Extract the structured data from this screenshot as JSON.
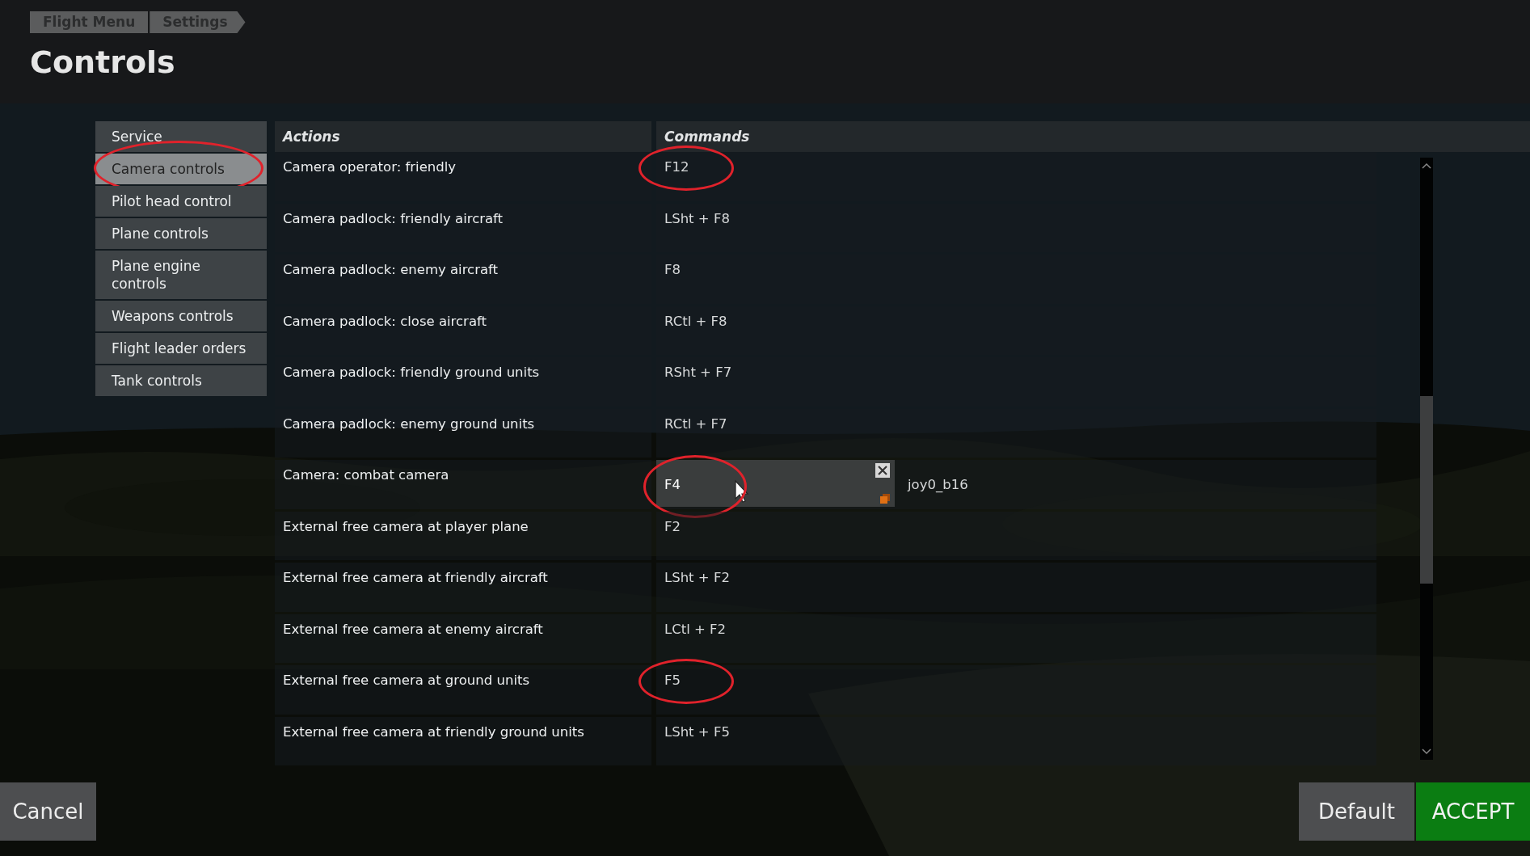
{
  "breadcrumb": [
    "Flight Menu",
    "Settings"
  ],
  "title": "Controls",
  "sidebar": {
    "items": [
      {
        "label": "Service",
        "selected": false,
        "circled": false
      },
      {
        "label": "Camera controls",
        "selected": true,
        "circled": true
      },
      {
        "label": "Pilot head control",
        "selected": false,
        "circled": false
      },
      {
        "label": "Plane controls",
        "selected": false,
        "circled": false
      },
      {
        "label": "Plane engine controls",
        "selected": false,
        "circled": false
      },
      {
        "label": "Weapons controls",
        "selected": false,
        "circled": false
      },
      {
        "label": "Flight leader orders",
        "selected": false,
        "circled": false
      },
      {
        "label": "Tank controls",
        "selected": false,
        "circled": false
      }
    ]
  },
  "table": {
    "columns": [
      "Actions",
      "Commands"
    ],
    "rows": [
      {
        "action": "Camera operator: friendly",
        "command": "F12",
        "circled": true,
        "editing": false
      },
      {
        "action": "Camera padlock: friendly aircraft",
        "command": "LSht + F8",
        "circled": false,
        "editing": false
      },
      {
        "action": "Camera padlock: enemy aircraft",
        "command": "F8",
        "circled": false,
        "editing": false
      },
      {
        "action": "Camera padlock: close aircraft",
        "command": "RCtl + F8",
        "circled": false,
        "editing": false
      },
      {
        "action": "Camera padlock: friendly ground units",
        "command": "RSht + F7",
        "circled": false,
        "editing": false
      },
      {
        "action": "Camera padlock: enemy ground units",
        "command": "RCtl + F7",
        "circled": false,
        "editing": false
      },
      {
        "action": "Camera: combat camera",
        "command": "F4",
        "secondary": "joy0_b16",
        "circled": true,
        "editing": true
      },
      {
        "action": "External free camera at player plane",
        "command": "F2",
        "circled": false,
        "editing": false
      },
      {
        "action": "External free camera at friendly aircraft",
        "command": "LSht + F2",
        "circled": false,
        "editing": false
      },
      {
        "action": "External free camera at enemy aircraft",
        "command": "LCtl + F2",
        "circled": false,
        "editing": false
      },
      {
        "action": "External free camera at ground units",
        "command": "F5",
        "circled": true,
        "editing": false
      },
      {
        "action": "External free camera at friendly ground units",
        "command": "LSht + F5",
        "circled": false,
        "editing": false
      }
    ]
  },
  "buttons": [
    {
      "label": "Cancel",
      "kind": "secondary"
    },
    {
      "label": "Default",
      "kind": "secondary"
    },
    {
      "label": "ACCEPT",
      "kind": "primary"
    }
  ]
}
